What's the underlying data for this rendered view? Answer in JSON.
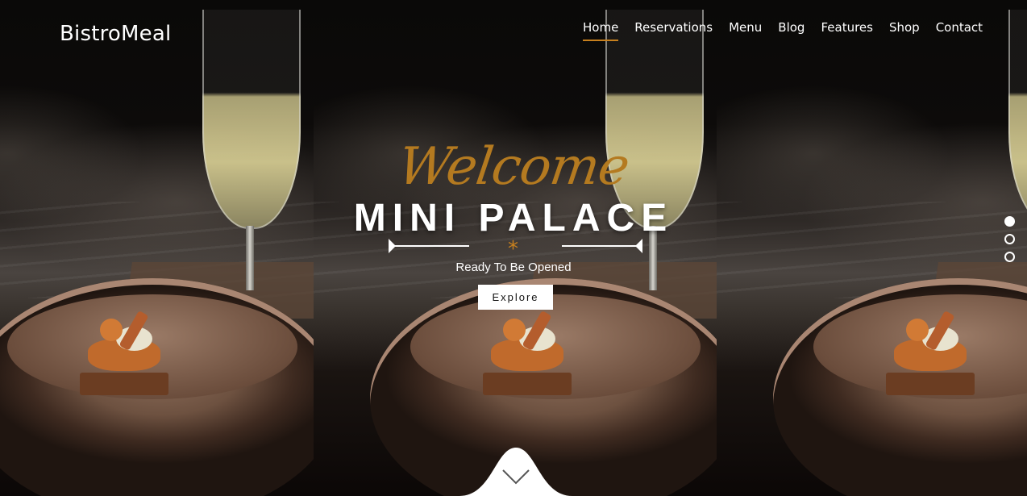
{
  "brand": {
    "logo": "BistroMeal"
  },
  "nav": {
    "items": [
      {
        "label": "Home",
        "active": true
      },
      {
        "label": "Reservations",
        "active": false
      },
      {
        "label": "Menu",
        "active": false
      },
      {
        "label": "Blog",
        "active": false
      },
      {
        "label": "Features",
        "active": false
      },
      {
        "label": "Shop",
        "active": false
      },
      {
        "label": "Contact",
        "active": false
      }
    ]
  },
  "hero": {
    "script_title": "Welcome",
    "title": "MINI PALACE",
    "ornament": "*",
    "subtitle": "Ready To Be Opened",
    "cta_label": "Explore"
  },
  "slider": {
    "count": 3,
    "active_index": 0
  },
  "colors": {
    "accent": "#c7801e",
    "script": "#b47a20",
    "text": "#ffffff"
  },
  "icons": {
    "scroll": "chevron-down-icon"
  }
}
